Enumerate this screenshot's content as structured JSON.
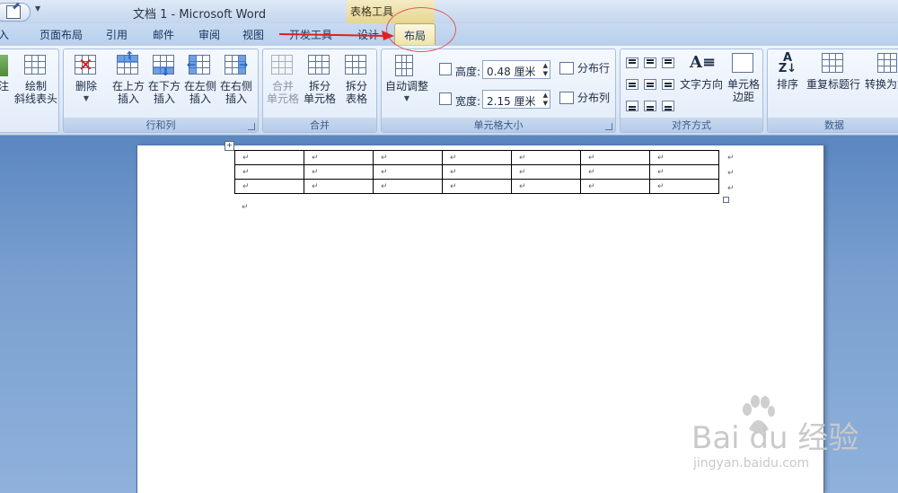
{
  "title_bar": {
    "doc_title": "文档 1 - Microsoft Word",
    "context_tools": "表格工具"
  },
  "tabs": [
    {
      "label": "插入",
      "partial": "入"
    },
    {
      "label": "页面布局"
    },
    {
      "label": "引用"
    },
    {
      "label": "邮件"
    },
    {
      "label": "审阅"
    },
    {
      "label": "视图"
    },
    {
      "label": "开发工具"
    },
    {
      "label": "设计"
    },
    {
      "label": "布局",
      "active": true
    }
  ],
  "ribbon": {
    "draw": {
      "edge_label": "注",
      "draw_label_1": "绘制",
      "draw_label_2": "斜线表头"
    },
    "rows_cols": {
      "group_label": "行和列",
      "delete": "删除",
      "insert_above_1": "在上方",
      "insert_above_2": "插入",
      "insert_below_1": "在下方",
      "insert_below_2": "插入",
      "insert_left_1": "在左侧",
      "insert_left_2": "插入",
      "insert_right_1": "在右侧",
      "insert_right_2": "插入"
    },
    "merge": {
      "group_label": "合并",
      "merge_cells_1": "合并",
      "merge_cells_2": "单元格",
      "split_cells_1": "拆分",
      "split_cells_2": "单元格",
      "split_table_1": "拆分",
      "split_table_2": "表格"
    },
    "cell_size": {
      "group_label": "单元格大小",
      "autofit": "自动调整",
      "height_label": "高度:",
      "height_value": "0.48 厘米",
      "width_label": "宽度:",
      "width_value": "2.15 厘米",
      "distribute_rows": "分布行",
      "distribute_cols": "分布列"
    },
    "alignment": {
      "group_label": "对齐方式",
      "text_direction": "文字方向",
      "cell_margins_1": "单元格",
      "cell_margins_2": "边距"
    },
    "data": {
      "group_label": "数据",
      "sort": "排序",
      "repeat_header": "重复标题行",
      "convert": "转换为文"
    }
  },
  "document": {
    "paragraph_mark": "↵",
    "table_rows": 3,
    "table_cols": 7
  },
  "watermark": {
    "main": "Bai du 经验",
    "sub": "jingyan.baidu.com"
  }
}
